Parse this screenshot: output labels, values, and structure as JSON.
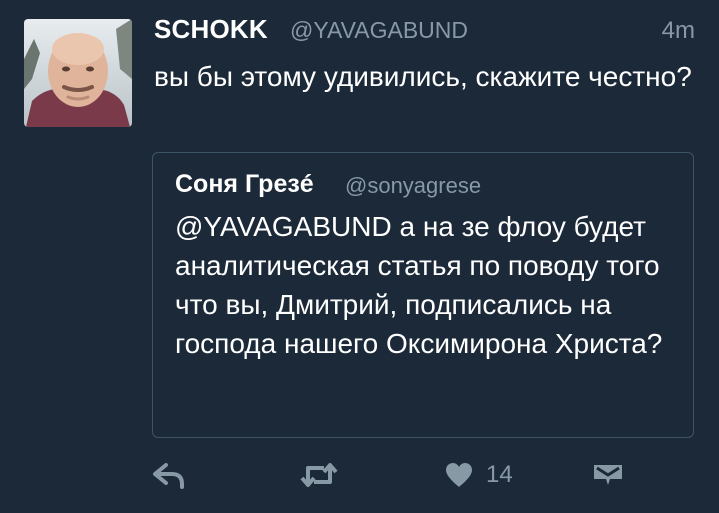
{
  "tweet": {
    "author_name": "SCHOKK",
    "author_handle": "@YAVAGABUND",
    "timestamp": "4m",
    "text": "вы бы этому удивились, скажите честно?",
    "avatar_icon": "user-avatar-photo"
  },
  "quoted_tweet": {
    "author_name": "Соня Грезé",
    "author_handle": "@sonyagrese",
    "text": "@YAVAGABUND а на зе флоу будет аналитическая статья по поводу того что вы, Дмитрий, подписались на господа нашего Оксимирона Христа?"
  },
  "actions": {
    "reply_icon": "reply-icon",
    "retweet_icon": "retweet-icon",
    "like_icon": "heart-icon",
    "like_count": "14",
    "dm_icon": "direct-message-icon"
  },
  "colors": {
    "background": "#1c2938",
    "secondary_text": "#8899a6",
    "quote_border": "#3d5466"
  }
}
